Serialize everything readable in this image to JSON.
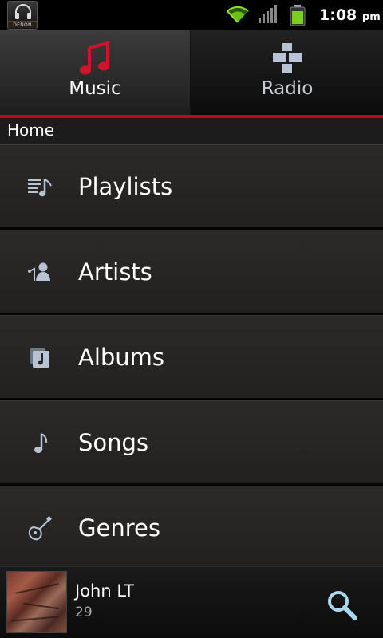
{
  "status_bar": {
    "app_icon_brand": "DENON",
    "time": "1:08",
    "ampm": "pm",
    "wifi_icon": "wifi-icon",
    "signal_icon": "signal-icon",
    "battery_icon": "battery-icon"
  },
  "tabs": [
    {
      "label": "Music",
      "icon": "music-note-icon",
      "active": true
    },
    {
      "label": "Radio",
      "icon": "tunein-icon",
      "active": false
    }
  ],
  "colors": {
    "accent": "#b0101e",
    "row_bg": "#2a2826",
    "icon_tint": "#b8c4d4"
  },
  "breadcrumb": {
    "label": "Home"
  },
  "list": [
    {
      "label": "Playlists",
      "icon": "playlist-icon"
    },
    {
      "label": "Artists",
      "icon": "artist-icon"
    },
    {
      "label": "Albums",
      "icon": "album-icon"
    },
    {
      "label": "Songs",
      "icon": "song-note-icon"
    },
    {
      "label": "Genres",
      "icon": "guitar-icon"
    }
  ],
  "now_playing": {
    "title": "John LT",
    "subtitle": "29",
    "search_icon": "search-icon"
  }
}
